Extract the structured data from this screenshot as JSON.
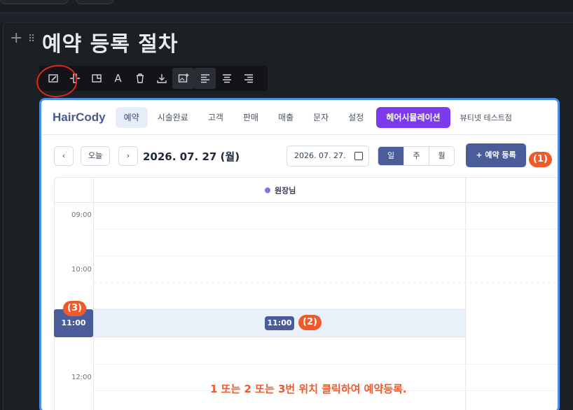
{
  "page": {
    "title": "예약 등록 절차"
  },
  "icons": {
    "block_add": "plus-icon",
    "block_drag": "drag-handle-icon"
  },
  "toolbar": {
    "buttons": [
      {
        "name": "image-edit-icon"
      },
      {
        "name": "resize-icon"
      },
      {
        "name": "image-crop-icon"
      },
      {
        "name": "text-icon",
        "glyph": "A"
      },
      {
        "name": "trash-icon"
      },
      {
        "name": "download-icon"
      },
      {
        "name": "image-add-icon"
      },
      {
        "name": "align-left-icon"
      },
      {
        "name": "align-center-icon"
      },
      {
        "name": "align-right-icon"
      }
    ]
  },
  "app": {
    "brand": "HairCody",
    "nav": [
      "예약",
      "시술완료",
      "고객",
      "판매",
      "매출",
      "문자",
      "설정"
    ],
    "nav_highlight": "헤어시뮬레이션",
    "shop_name": "뷰티넷 테스트점",
    "cal": {
      "prev": "‹",
      "today": "오늘",
      "next": "›",
      "date_title": "2026. 07. 27 (월)",
      "date_input": "2026. 07. 27.",
      "views": [
        "일",
        "주",
        "월"
      ],
      "add_button": "+ 예약 등록"
    },
    "grid": {
      "staff": "원장님",
      "times": [
        "09:00",
        "10:00",
        "11:00",
        "12:00"
      ],
      "selected_time": "11:00",
      "chip_time": "11:00"
    }
  },
  "annotations": {
    "badge1": "(1)",
    "badge2": "(2)",
    "badge3": "(3)",
    "instruction": "1 또는 2 또는 3번 위치 클릭하여  예약등록."
  },
  "colors": {
    "accent_blue": "#4a5d9a",
    "accent_purple": "#7c3aed",
    "annotation_red": "#ef5a2a",
    "frame_border": "#4a8fe6"
  }
}
